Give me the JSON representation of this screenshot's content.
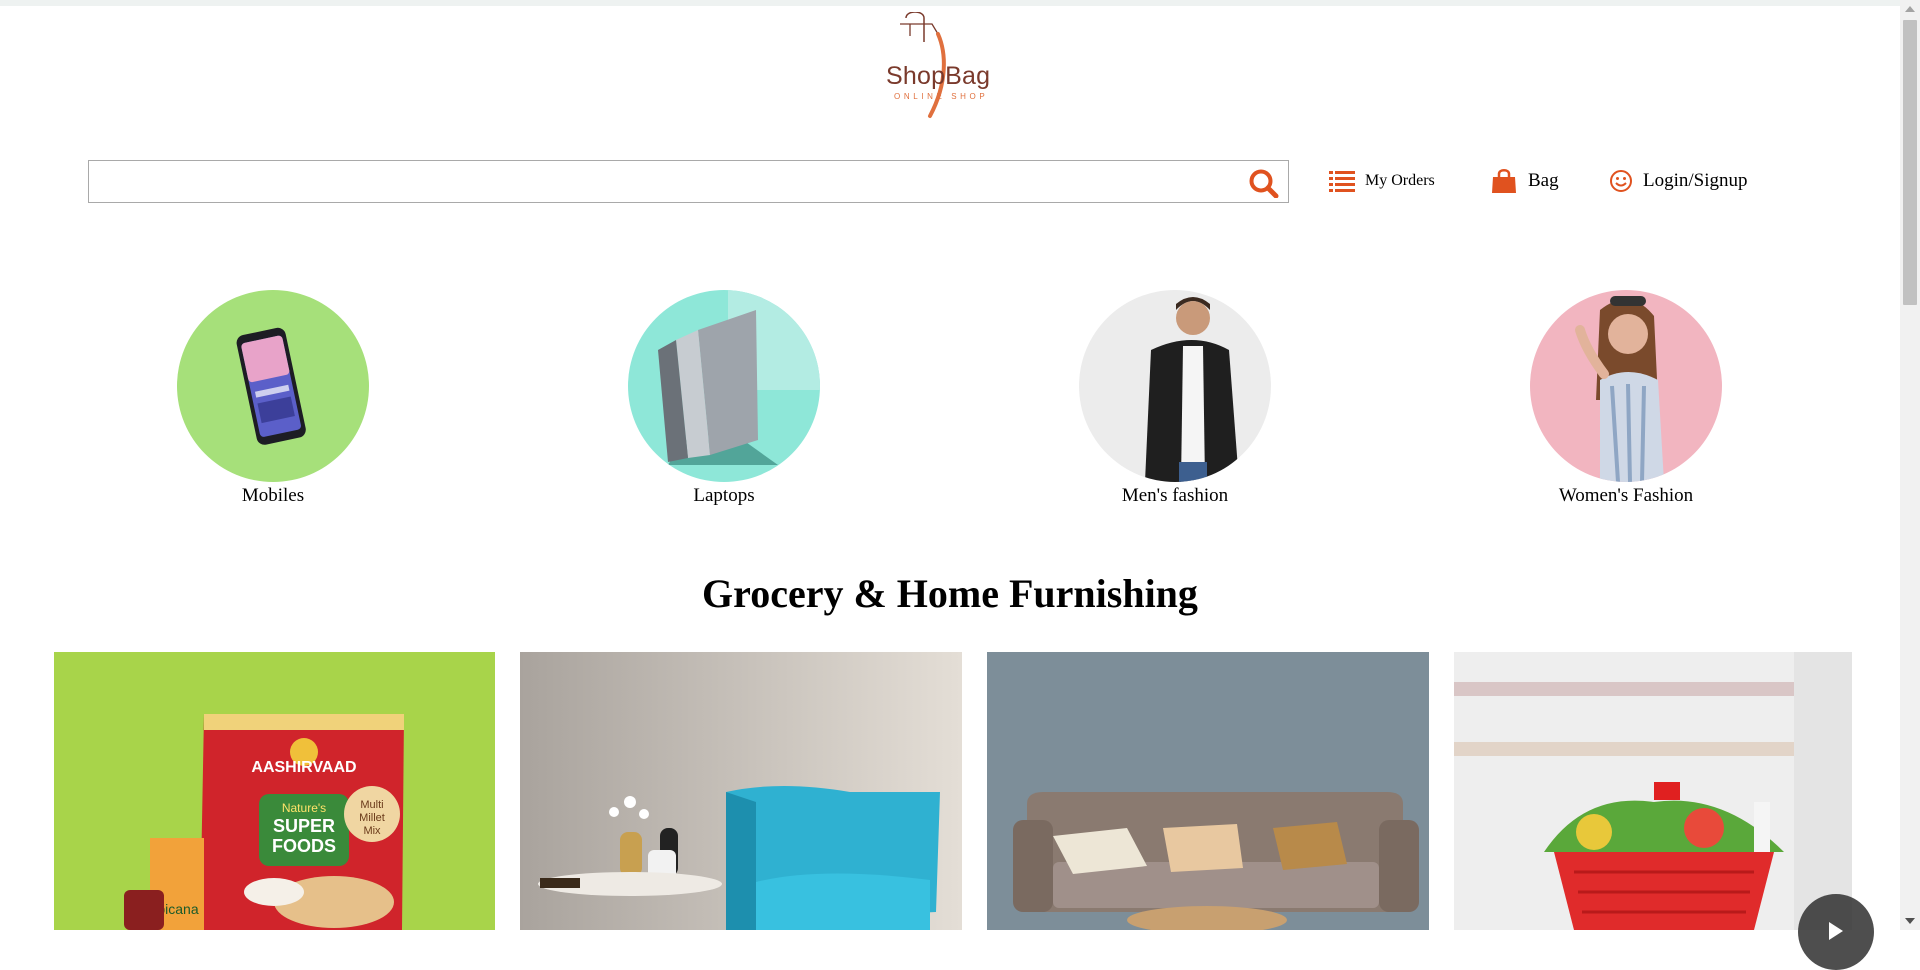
{
  "brand": {
    "name": "ShopBag",
    "tagline": "ONLINE SHOP",
    "logo_color": "#7a3a2c",
    "accent": "#e0703e"
  },
  "search": {
    "value": "",
    "placeholder": "",
    "icon": "search-icon"
  },
  "nav": {
    "orders_label": "My Orders",
    "orders_icon": "list-icon",
    "bag_label": "Bag",
    "bag_icon": "shopping-bag-icon",
    "login_label": "Login/Signup",
    "login_icon": "smiley-icon"
  },
  "categories": [
    {
      "label": "Mobiles",
      "bg": "#a6e07a",
      "icon": "smartphone-image"
    },
    {
      "label": "Laptops",
      "bg": "#8ee7d8",
      "icon": "laptop-image"
    },
    {
      "label": "Men's fashion",
      "bg": "#ececec",
      "icon": "man-image"
    },
    {
      "label": "Women's Fashion",
      "bg": "#f2b5c0",
      "icon": "woman-image"
    }
  ],
  "section": {
    "title": "Grocery & Home Furnishing"
  },
  "cards": [
    {
      "name": "grocery-flour-card",
      "icon": "grocery-products-image"
    },
    {
      "name": "armchair-card",
      "icon": "armchair-image"
    },
    {
      "name": "sofa-card",
      "icon": "sofa-image"
    },
    {
      "name": "grocery-basket-card",
      "icon": "basket-image"
    }
  ],
  "card_texts": {
    "brand": "AASHIRVAAD",
    "line1": "Nature's",
    "line2": "SUPER",
    "line3": "FOODS",
    "badge1": "Multi",
    "badge2": "Millet",
    "badge3": "Mix",
    "juice": "picana"
  },
  "carousel": {
    "next_icon": "play-arrow-icon"
  }
}
